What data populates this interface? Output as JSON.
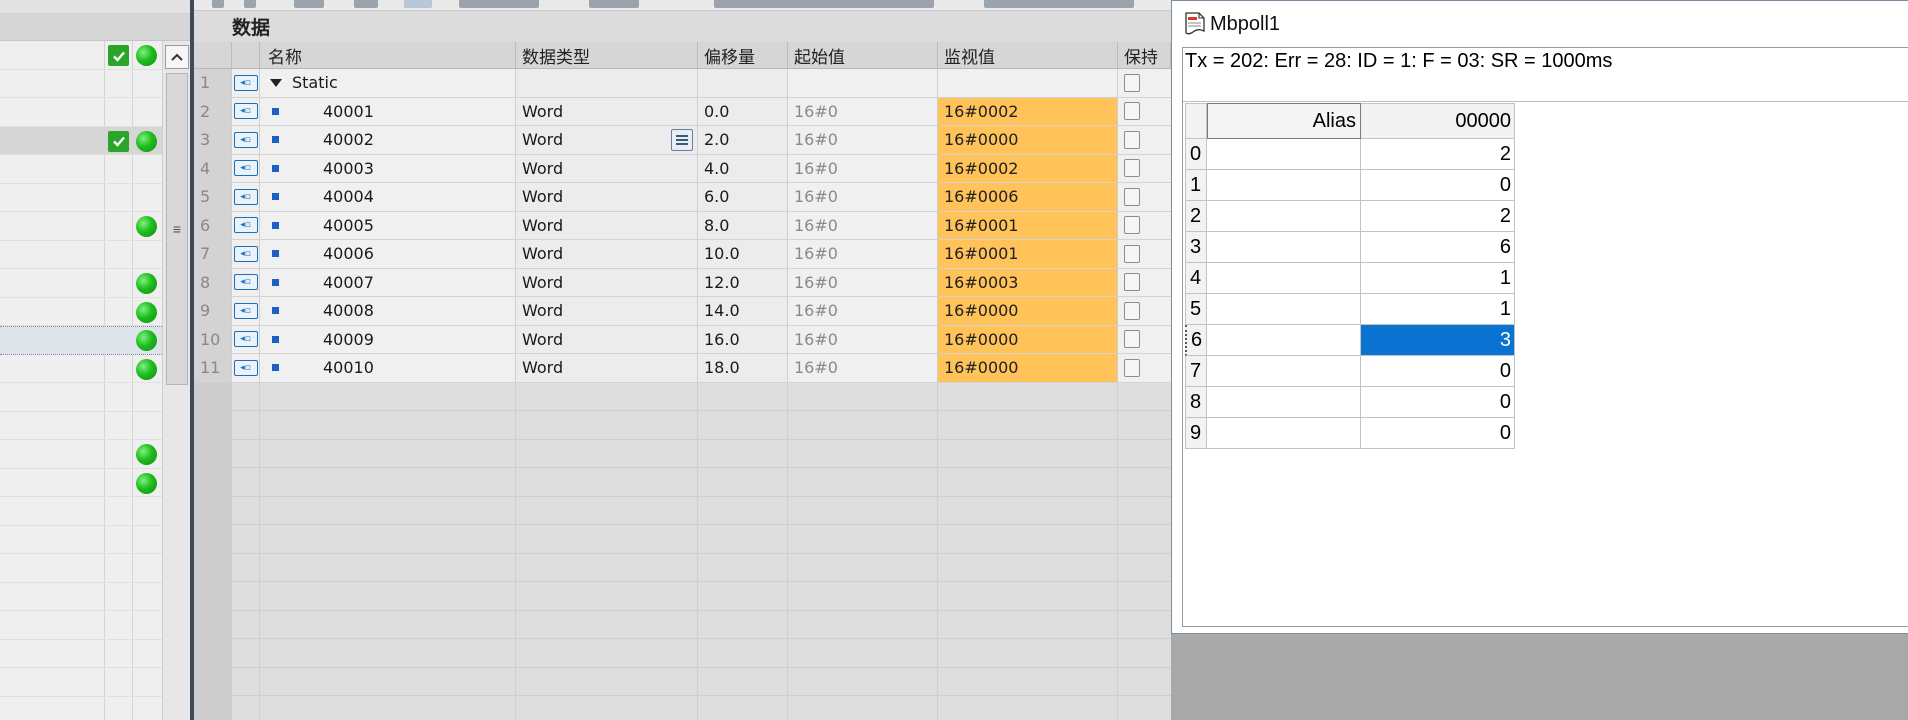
{
  "editor": {
    "title": "数据",
    "columns": {
      "name": "名称",
      "type": "数据类型",
      "offset": "偏移量",
      "start": "起始值",
      "monitor": "监视值",
      "retain": "保持"
    },
    "root_row": {
      "num": "1",
      "name": "Static"
    },
    "rows": [
      {
        "num": "2",
        "name": "40001",
        "type": "Word",
        "offset": "0.0",
        "start": "16#0",
        "monitor": "16#0002"
      },
      {
        "num": "3",
        "name": "40002",
        "type": "Word",
        "offset": "2.0",
        "start": "16#0",
        "monitor": "16#0000"
      },
      {
        "num": "4",
        "name": "40003",
        "type": "Word",
        "offset": "4.0",
        "start": "16#0",
        "monitor": "16#0002"
      },
      {
        "num": "5",
        "name": "40004",
        "type": "Word",
        "offset": "6.0",
        "start": "16#0",
        "monitor": "16#0006"
      },
      {
        "num": "6",
        "name": "40005",
        "type": "Word",
        "offset": "8.0",
        "start": "16#0",
        "monitor": "16#0001"
      },
      {
        "num": "7",
        "name": "40006",
        "type": "Word",
        "offset": "10.0",
        "start": "16#0",
        "monitor": "16#0001"
      },
      {
        "num": "8",
        "name": "40007",
        "type": "Word",
        "offset": "12.0",
        "start": "16#0",
        "monitor": "16#0003"
      },
      {
        "num": "9",
        "name": "40008",
        "type": "Word",
        "offset": "14.0",
        "start": "16#0",
        "monitor": "16#0000"
      },
      {
        "num": "10",
        "name": "40009",
        "type": "Word",
        "offset": "16.0",
        "start": "16#0",
        "monitor": "16#0000"
      },
      {
        "num": "11",
        "name": "40010",
        "type": "Word",
        "offset": "18.0",
        "start": "16#0",
        "monitor": "16#0000"
      }
    ],
    "colors": {
      "monitor_bg": "#ffc35a",
      "tag_icon": "#1d6fb8"
    }
  },
  "mbpoll": {
    "title": "Mbpoll1",
    "status": "Tx = 202: Err = 28: ID = 1: F = 03: SR = 1000ms",
    "alias_header": "Alias",
    "value_header": "00000",
    "rows": [
      {
        "idx": "0",
        "value": "2"
      },
      {
        "idx": "1",
        "value": "0"
      },
      {
        "idx": "2",
        "value": "2"
      },
      {
        "idx": "3",
        "value": "6"
      },
      {
        "idx": "4",
        "value": "1"
      },
      {
        "idx": "5",
        "value": "1"
      },
      {
        "idx": "6",
        "value": "3"
      },
      {
        "idx": "7",
        "value": "0"
      },
      {
        "idx": "8",
        "value": "0"
      },
      {
        "idx": "9",
        "value": "0"
      }
    ],
    "selected_index": "6",
    "colors": {
      "selection": "#0a72d1"
    }
  },
  "left_pane": {
    "status_icons": [
      "checkmark-icon",
      "status-ok-icon"
    ]
  }
}
